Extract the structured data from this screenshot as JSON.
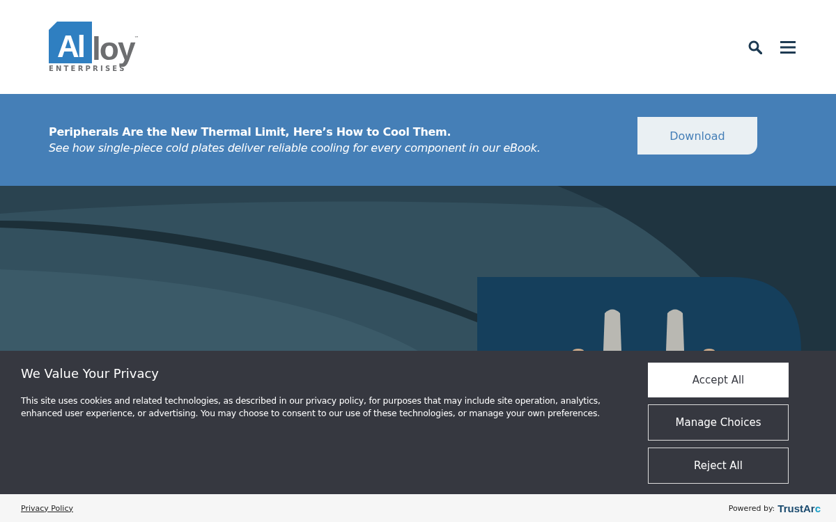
{
  "header": {
    "logo": {
      "mark": "Al",
      "word": "loy",
      "trademark": "™",
      "tagline": "ENTERPRISES"
    }
  },
  "promo": {
    "headline": "Peripherals Are the New Thermal Limit, Here’s How to Cool Them.",
    "subline": "See how single-piece cold plates deliver reliable cooling for every component in our eBook.",
    "button": "Download"
  },
  "cookie_banner": {
    "title": "We Value Your Privacy",
    "body": "This site uses cookies and related technologies, as described in our privacy policy, for purposes that may include site operation, analytics, enhanced user experience, or advertising. You may choose to consent to our use of these technologies, or manage your own preferences.",
    "buttons": [
      {
        "label": "Accept All",
        "kind": "primary"
      },
      {
        "label": "Manage Choices",
        "kind": "outline"
      },
      {
        "label": "Reject All",
        "kind": "outline"
      }
    ],
    "footer": {
      "link": "Privacy Policy",
      "powered_by": "Powered by:",
      "brand_main": "TrustAr",
      "brand_end": "c"
    }
  }
}
